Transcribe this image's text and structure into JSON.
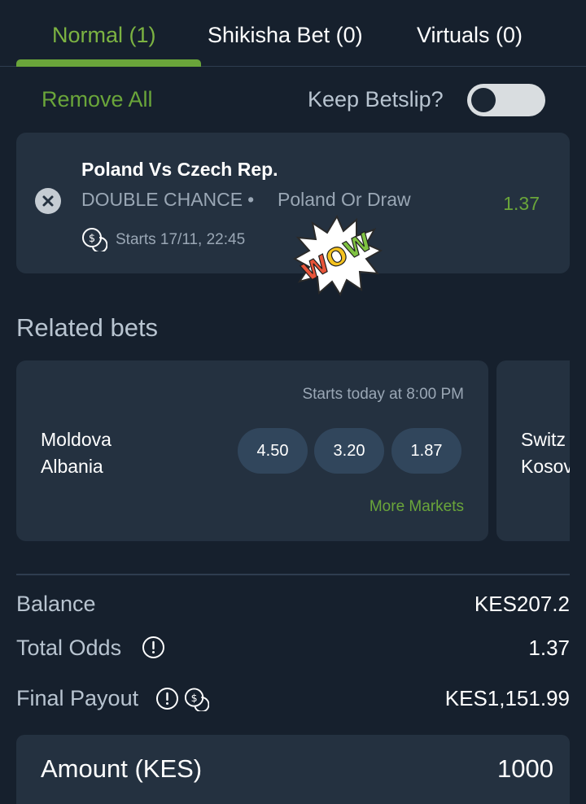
{
  "tabs": [
    {
      "label": "Normal (1)",
      "active": true
    },
    {
      "label": "Shikisha Bet (0)",
      "active": false
    },
    {
      "label": "Virtuals (0)",
      "active": false
    }
  ],
  "controls": {
    "remove_all": "Remove All",
    "keep_betslip": "Keep Betslip?",
    "keep_betslip_on": false
  },
  "bet": {
    "match": "Poland Vs Czech Rep.",
    "market": "DOUBLE CHANCE",
    "separator": "•",
    "selection": "Poland Or Draw",
    "odds": "1.37",
    "starts": "Starts 17/11, 22:45"
  },
  "sticker": {
    "text": "WOW"
  },
  "related": {
    "title": "Related bets",
    "cards": [
      {
        "starts": "Starts today at 8:00 PM",
        "home": "Moldova",
        "away": "Albania",
        "odds": [
          "4.50",
          "3.20",
          "1.87"
        ],
        "more": "More Markets"
      },
      {
        "home": "Switz",
        "away": "Kosov"
      }
    ]
  },
  "summary": {
    "balance_label": "Balance",
    "balance_value": "KES207.2",
    "total_odds_label": "Total Odds",
    "total_odds_value": "1.37",
    "payout_label": "Final Payout",
    "payout_value": "KES1,151.99"
  },
  "amount": {
    "label": "Amount (KES)",
    "value": "1000"
  },
  "colors": {
    "background": "#16202d",
    "card": "#243140",
    "accent_green": "#6aa53a"
  }
}
